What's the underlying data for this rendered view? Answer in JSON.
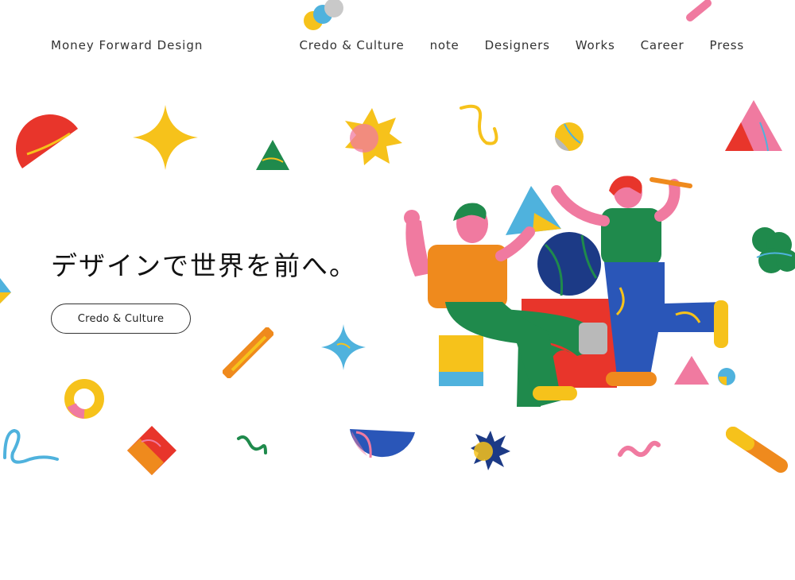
{
  "header": {
    "brand": "Money Forward Design",
    "nav": [
      "Credo & Culture",
      "note",
      "Designers",
      "Works",
      "Career",
      "Press"
    ]
  },
  "hero": {
    "title": "デザインで世界を前へ。",
    "cta_label": "Credo & Culture"
  },
  "colors": {
    "red": "#e8352b",
    "yellow": "#f6c21b",
    "pink": "#f07aa0",
    "blue": "#2a56b8",
    "navy": "#1c3a86",
    "green": "#1f8a4c",
    "orange": "#ef8a1d",
    "sky": "#4fb2dd"
  }
}
